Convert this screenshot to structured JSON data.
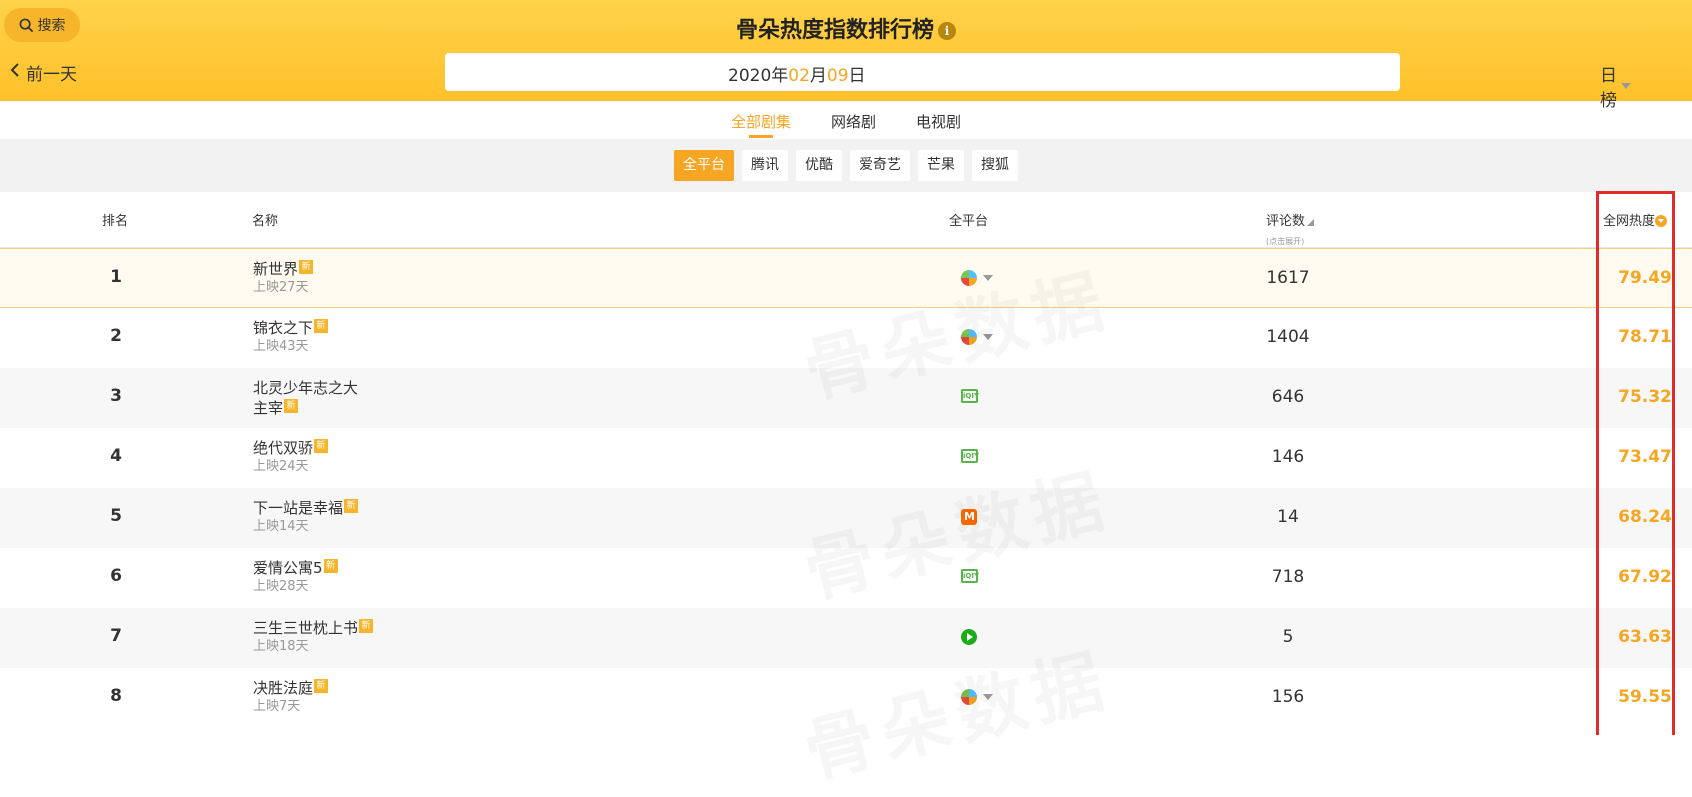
{
  "header": {
    "search_label": "搜索",
    "prev_day_label": "前一天",
    "title": "骨朵热度指数排行榜",
    "info_icon": "i",
    "date": {
      "year": "2020",
      "year_unit": "年",
      "month": "02",
      "month_unit": "月",
      "day": "09",
      "day_unit": "日"
    },
    "rank_type": "日榜"
  },
  "category_tabs": [
    {
      "label": "全部剧集",
      "active": true
    },
    {
      "label": "网络剧",
      "active": false
    },
    {
      "label": "电视剧",
      "active": false
    }
  ],
  "platforms": [
    {
      "label": "全平台",
      "active": true
    },
    {
      "label": "腾讯",
      "active": false
    },
    {
      "label": "优酷",
      "active": false
    },
    {
      "label": "爱奇艺",
      "active": false
    },
    {
      "label": "芒果",
      "active": false
    },
    {
      "label": "搜狐",
      "active": false
    }
  ],
  "table": {
    "headers": {
      "rank": "排名",
      "name": "名称",
      "platform": "全平台",
      "comments": "评论数",
      "comments_sub": "(点击展开)",
      "heat": "全网热度"
    },
    "new_badge": "新",
    "rows": [
      {
        "rank": "1",
        "name": "新世界",
        "name2": "",
        "days": "上映27天",
        "platform_icon": "multi-platform-icon",
        "comments": "1617",
        "heat": "79.49"
      },
      {
        "rank": "2",
        "name": "锦衣之下",
        "name2": "",
        "days": "上映43天",
        "platform_icon": "multi-platform-icon",
        "comments": "1404",
        "heat": "78.71"
      },
      {
        "rank": "3",
        "name": "北灵少年志之大",
        "name2": "主宰",
        "days": "",
        "platform_icon": "iqiyi-icon",
        "comments": "646",
        "heat": "75.32"
      },
      {
        "rank": "4",
        "name": "绝代双骄",
        "name2": "",
        "days": "上映24天",
        "platform_icon": "iqiyi-icon",
        "comments": "146",
        "heat": "73.47"
      },
      {
        "rank": "5",
        "name": "下一站是幸福",
        "name2": "",
        "days": "上映14天",
        "platform_icon": "mango-icon",
        "comments": "14",
        "heat": "68.24"
      },
      {
        "rank": "6",
        "name": "爱情公寓5",
        "name2": "",
        "days": "上映28天",
        "platform_icon": "iqiyi-icon",
        "comments": "718",
        "heat": "67.92"
      },
      {
        "rank": "7",
        "name": "三生三世枕上书",
        "name2": "",
        "days": "上映18天",
        "platform_icon": "tencent-icon",
        "comments": "5",
        "heat": "63.63"
      },
      {
        "rank": "8",
        "name": "决胜法庭",
        "name2": "",
        "days": "上映7天",
        "platform_icon": "multi-platform-icon",
        "comments": "156",
        "heat": "59.55"
      }
    ]
  },
  "watermark": {
    "text": "骨朵数据"
  },
  "colors": {
    "accent": "#f6a623",
    "header_bg": "#ffc12a",
    "highlight": "#e02c2c"
  }
}
